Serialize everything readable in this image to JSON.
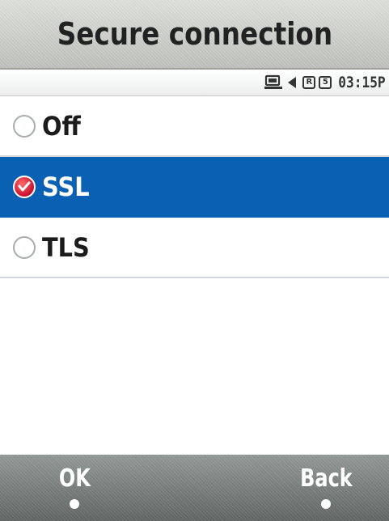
{
  "header": {
    "title": "Secure connection"
  },
  "status_bar": {
    "icons": [
      "network-icon",
      "volume-icon",
      "r-box-icon",
      "battery-icon"
    ],
    "r_box_text": "R",
    "five_box_text": "5",
    "time": "03:15P"
  },
  "options": [
    {
      "label": "Off",
      "selected": false
    },
    {
      "label": "SSL",
      "selected": true
    },
    {
      "label": "TLS",
      "selected": false
    }
  ],
  "softkeys": {
    "left_label": "OK",
    "right_label": "Back"
  },
  "colors": {
    "selection": "#0a60b2",
    "checked_radio": "#c8102e",
    "softbar": "#6f7674",
    "titlebar": "#c8cac6"
  }
}
